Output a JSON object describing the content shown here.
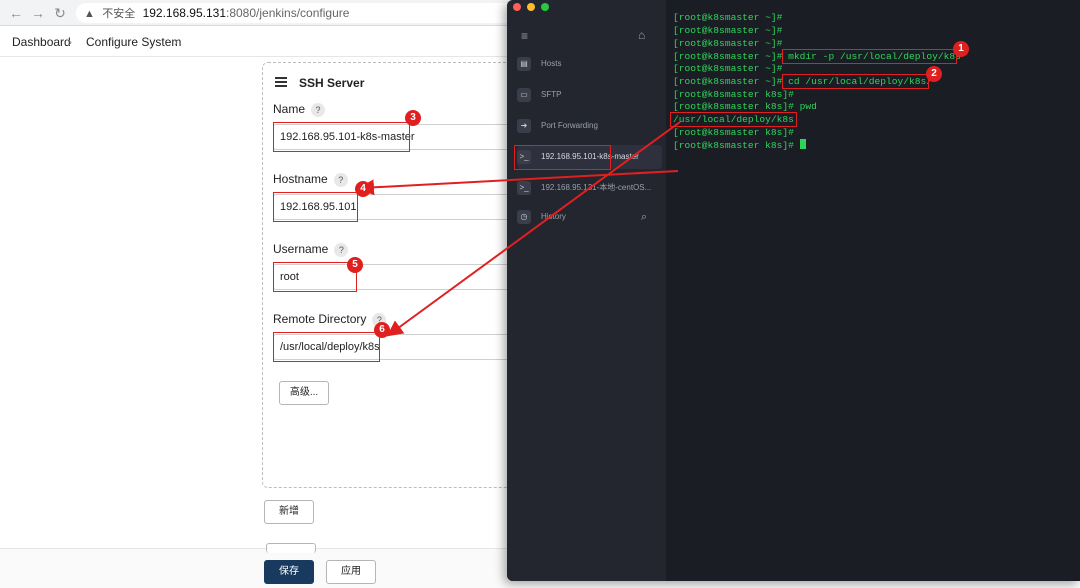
{
  "browser": {
    "url_warning": "不安全",
    "url_host": "192.168.95.131",
    "url_path": ":8080/jenkins/configure"
  },
  "breadcrumb": {
    "items": [
      "Dashboard",
      "Configure System"
    ]
  },
  "ssh_server": {
    "title": "SSH Server",
    "fields": {
      "name": {
        "label": "Name",
        "value": "192.168.95.101-k8s-master"
      },
      "hostname": {
        "label": "Hostname",
        "value": "192.168.95.101"
      },
      "username": {
        "label": "Username",
        "value": "root"
      },
      "remote_dir": {
        "label": "Remote Directory",
        "value": "/usr/local/deploy/k8s"
      }
    },
    "help_glyph": "?",
    "advanced_label": "高级..."
  },
  "buttons": {
    "add_label": "新增",
    "save_label": "保存",
    "apply_label": "应用"
  },
  "terminal": {
    "sidebar": [
      {
        "label": "Hosts",
        "icon": "server-icon"
      },
      {
        "label": "SFTP",
        "icon": "folder-icon"
      },
      {
        "label": "Port Forwarding",
        "icon": "forward-arrow-icon"
      },
      {
        "label": "192.168.95.101-k8s-master",
        "icon": "terminal-icon"
      },
      {
        "label": "192.168.95.131-本地-centOS...",
        "icon": "terminal-icon"
      },
      {
        "label": "History",
        "icon": "history-icon"
      }
    ],
    "lines": [
      "[root@k8smaster ~]#",
      "[root@k8smaster ~]#",
      "[root@k8smaster ~]#",
      "[root@k8smaster ~]# mkdir -p /usr/local/deploy/k8s",
      "[root@k8smaster ~]#",
      "[root@k8smaster ~]# cd /usr/local/deploy/k8s/",
      "[root@k8smaster k8s]#",
      "[root@k8smaster k8s]# pwd",
      "/usr/local/deploy/k8s",
      "[root@k8smaster k8s]#",
      "[root@k8smaster k8s]# "
    ],
    "text_color": "#2fd45a"
  },
  "annotations": {
    "badges": [
      "1",
      "2",
      "3",
      "4",
      "5",
      "6"
    ],
    "color": "#e02020"
  }
}
